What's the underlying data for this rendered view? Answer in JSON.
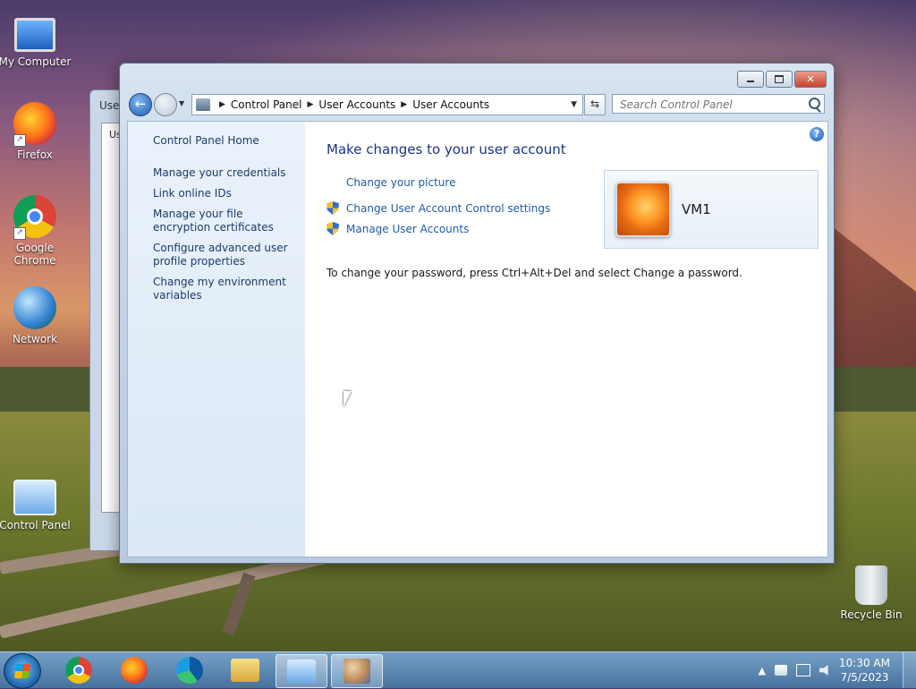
{
  "desktop": {
    "icons": [
      {
        "label": "My Computer"
      },
      {
        "label": "Firefox"
      },
      {
        "label": "Google Chrome"
      },
      {
        "label": "Network"
      },
      {
        "label": "Control Panel"
      },
      {
        "label": "Recycle Bin"
      }
    ],
    "shortcut_glyph": "↗"
  },
  "background_window": {
    "title": "User",
    "inner_text": "Us"
  },
  "window": {
    "controls": {
      "close_label": "✕"
    },
    "nav": {
      "back_glyph": "←",
      "dropdown_glyph": "▼",
      "refresh_glyph": "⇆"
    },
    "breadcrumb": [
      "Control Panel",
      "User Accounts",
      "User Accounts"
    ],
    "search": {
      "placeholder": "Search Control Panel"
    },
    "help_glyph": "?",
    "sidebar": {
      "home": "Control Panel Home",
      "links": [
        "Manage your credentials",
        "Link online IDs",
        "Manage your file encryption certificates",
        "Configure advanced user profile properties",
        "Change my environment variables"
      ]
    },
    "main": {
      "heading": "Make changes to your user account",
      "tasks": [
        {
          "label": "Change your picture",
          "icon": "none"
        },
        {
          "label": "Change User Account Control settings",
          "icon": "shield-icon"
        },
        {
          "label": "Manage User Accounts",
          "icon": "shield-icon"
        }
      ],
      "user": {
        "name": "VM1"
      },
      "password_note": "To change your password, press Ctrl+Alt+Del and select Change a password."
    }
  },
  "taskbar": {
    "apps": [
      "Google Chrome",
      "Firefox",
      "Microsoft Edge",
      "Windows Explorer",
      "Control Panel",
      "User Accounts"
    ],
    "tray": {
      "arrow": "▲"
    },
    "clock": {
      "time": "10:30 AM",
      "date": "7/5/2023"
    }
  }
}
